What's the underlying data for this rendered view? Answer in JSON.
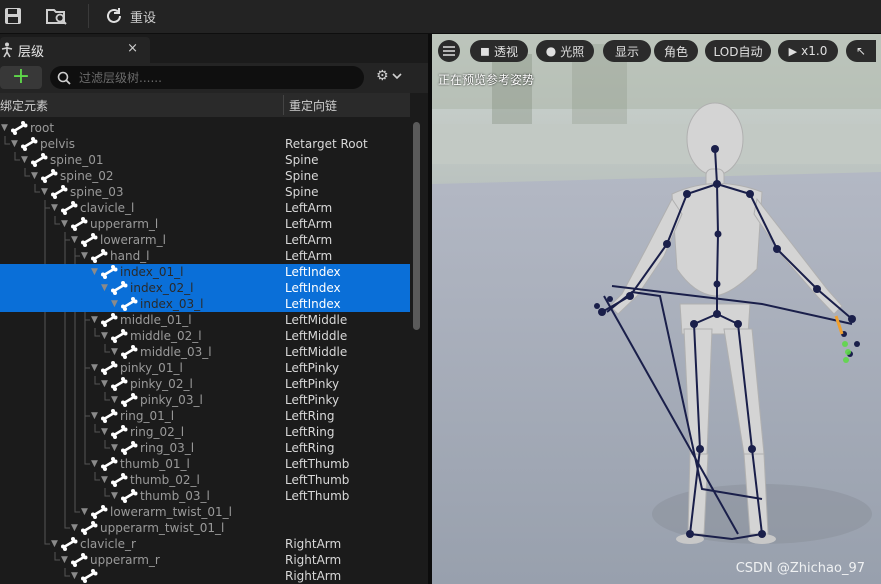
{
  "toolbar": {
    "save_icon": "save-icon",
    "browse_icon": "folder-search-icon",
    "reset_label": "重设"
  },
  "panel": {
    "tab_title": "层级",
    "tab_close": "×",
    "add_label": "+",
    "search_placeholder": "过滤层级树......",
    "col_bone": "绑定元素",
    "col_chain": "重定向链"
  },
  "tree": [
    {
      "name": "root",
      "chain": "",
      "depth": 0,
      "selected": false
    },
    {
      "name": "pelvis",
      "chain": "Retarget Root",
      "depth": 1,
      "selected": false
    },
    {
      "name": "spine_01",
      "chain": "Spine",
      "depth": 2,
      "selected": false
    },
    {
      "name": "spine_02",
      "chain": "Spine",
      "depth": 3,
      "selected": false
    },
    {
      "name": "spine_03",
      "chain": "Spine",
      "depth": 4,
      "selected": false
    },
    {
      "name": "clavicle_l",
      "chain": "LeftArm",
      "depth": 5,
      "selected": false
    },
    {
      "name": "upperarm_l",
      "chain": "LeftArm",
      "depth": 6,
      "selected": false
    },
    {
      "name": "lowerarm_l",
      "chain": "LeftArm",
      "depth": 7,
      "selected": false
    },
    {
      "name": "hand_l",
      "chain": "LeftArm",
      "depth": 8,
      "selected": false
    },
    {
      "name": "index_01_l",
      "chain": "LeftIndex",
      "depth": 9,
      "selected": true
    },
    {
      "name": "index_02_l",
      "chain": "LeftIndex",
      "depth": 10,
      "selected": true
    },
    {
      "name": "index_03_l",
      "chain": "LeftIndex",
      "depth": 11,
      "selected": true
    },
    {
      "name": "middle_01_l",
      "chain": "LeftMiddle",
      "depth": 9,
      "selected": false
    },
    {
      "name": "middle_02_l",
      "chain": "LeftMiddle",
      "depth": 10,
      "selected": false
    },
    {
      "name": "middle_03_l",
      "chain": "LeftMiddle",
      "depth": 11,
      "selected": false
    },
    {
      "name": "pinky_01_l",
      "chain": "LeftPinky",
      "depth": 9,
      "selected": false
    },
    {
      "name": "pinky_02_l",
      "chain": "LeftPinky",
      "depth": 10,
      "selected": false
    },
    {
      "name": "pinky_03_l",
      "chain": "LeftPinky",
      "depth": 11,
      "selected": false
    },
    {
      "name": "ring_01_l",
      "chain": "LeftRing",
      "depth": 9,
      "selected": false
    },
    {
      "name": "ring_02_l",
      "chain": "LeftRing",
      "depth": 10,
      "selected": false
    },
    {
      "name": "ring_03_l",
      "chain": "LeftRing",
      "depth": 11,
      "selected": false
    },
    {
      "name": "thumb_01_l",
      "chain": "LeftThumb",
      "depth": 9,
      "selected": false
    },
    {
      "name": "thumb_02_l",
      "chain": "LeftThumb",
      "depth": 10,
      "selected": false
    },
    {
      "name": "thumb_03_l",
      "chain": "LeftThumb",
      "depth": 11,
      "selected": false
    },
    {
      "name": "lowerarm_twist_01_l",
      "chain": "",
      "depth": 8,
      "selected": false
    },
    {
      "name": "upperarm_twist_01_l",
      "chain": "",
      "depth": 7,
      "selected": false
    },
    {
      "name": "clavicle_r",
      "chain": "RightArm",
      "depth": 5,
      "selected": false
    },
    {
      "name": "upperarm_r",
      "chain": "RightArm",
      "depth": 6,
      "selected": false
    },
    {
      "name": "",
      "chain": "RightArm",
      "depth": 7,
      "selected": false
    }
  ],
  "viewport": {
    "menu_icon": "hamburger-icon",
    "perspective_label": "透视",
    "lit_label": "光照",
    "show_label": "显示",
    "character_label": "角色",
    "lod_label": "LOD自动",
    "speed_label": "x1.0",
    "preview_label": "正在预览参考姿势",
    "watermark": "CSDN @Zhichao_97"
  },
  "colors": {
    "selection": "#0a6fd8",
    "add_green": "#5fd94a",
    "skeleton": "#1a1f4a"
  }
}
